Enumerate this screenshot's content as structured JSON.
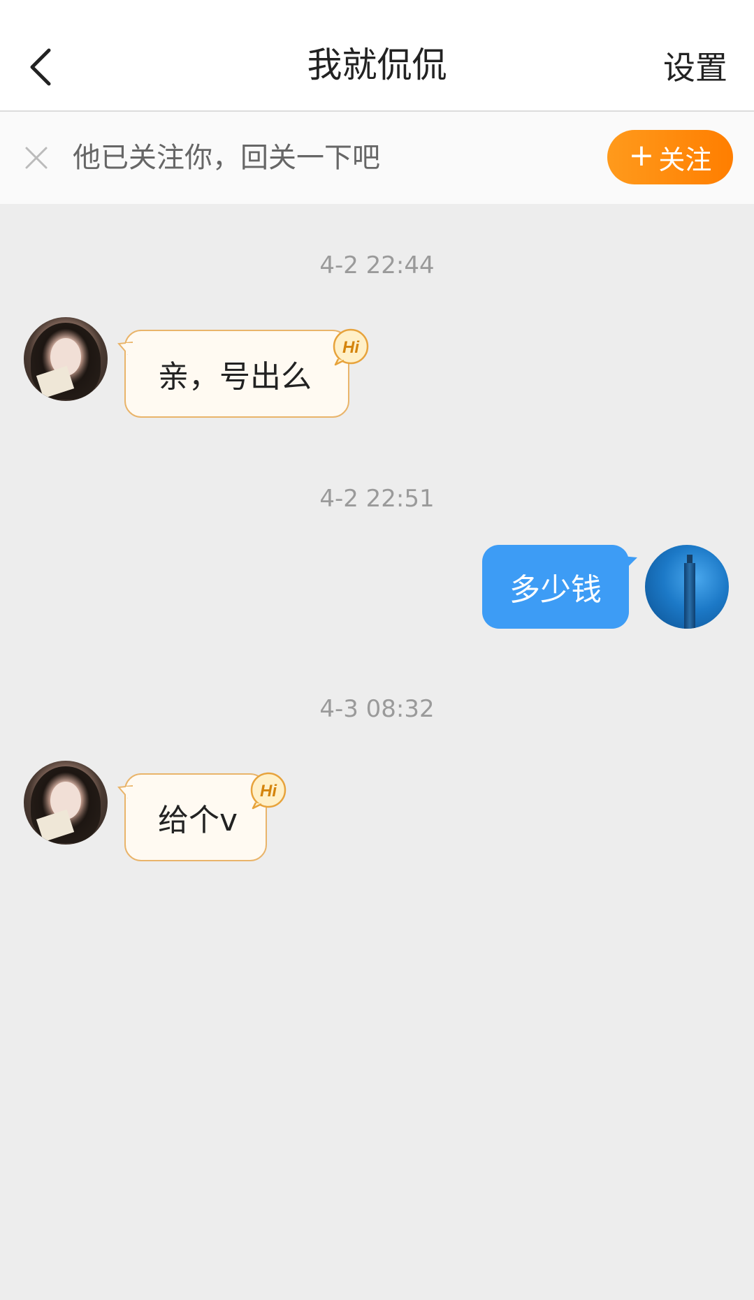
{
  "header": {
    "title": "我就侃侃",
    "settings_label": "设置"
  },
  "follow_banner": {
    "text": "他已关注你，回关一下吧",
    "button_plus": "+",
    "button_label": "关注",
    "button_color": "#ff8a0a"
  },
  "messages": [
    {
      "timestamp": "4-2 22:44",
      "side": "left",
      "text": "亲，号出么"
    },
    {
      "timestamp": "4-2 22:51",
      "side": "right",
      "text": "多少钱"
    },
    {
      "timestamp": "4-3 08:32",
      "side": "left",
      "text": "给个v"
    }
  ],
  "badges": {
    "hi_label": "Hi"
  },
  "colors": {
    "outgoing_bubble": "#3d9cf5",
    "incoming_bubble_bg": "#fffaf2",
    "incoming_bubble_border": "#e9b46a",
    "background": "#ededed"
  },
  "icons": {
    "back": "chevron-left-icon",
    "close": "close-icon",
    "peer_avatar": "avatar-girl",
    "self_avatar": "avatar-rocket"
  }
}
